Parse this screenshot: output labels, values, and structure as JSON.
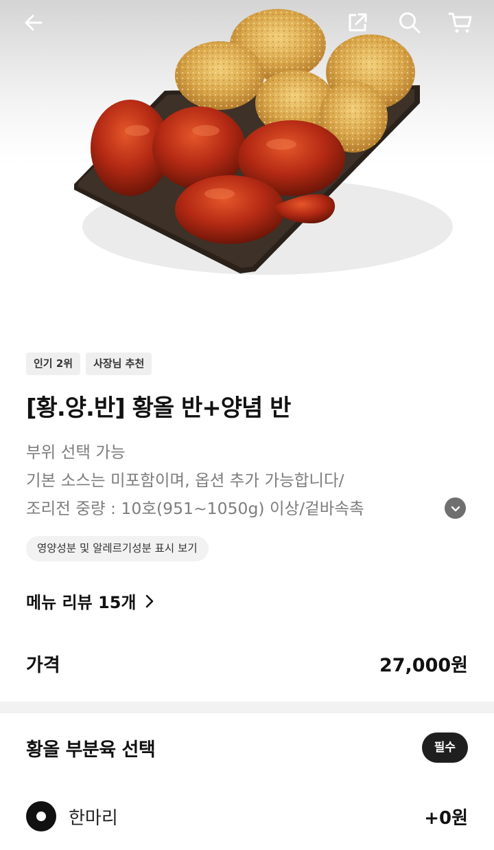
{
  "header": {
    "back_icon": "arrow-left-icon",
    "share_icon": "share-external-icon",
    "search_icon": "search-icon",
    "cart_icon": "cart-icon"
  },
  "product": {
    "badges": [
      "인기 2위",
      "사장님 추천"
    ],
    "title": "[황.양.반] 황올 반+양념 반",
    "description_lines": [
      "부위 선택 가능",
      "기본 소스는 미포함이며, 옵션 추가 가능합니다/",
      "조리전 중량 : 10호(951~1050g) 이상/겉바속촉"
    ],
    "nutrition_link": "영양성분 및 알레르기성분 표시 보기",
    "review_link": "메뉴 리뷰 15개",
    "price_label": "가격",
    "price_value": "27,000원"
  },
  "option_group": {
    "title": "황올 부분육 선택",
    "required_label": "필수",
    "options": [
      {
        "name": "한마리",
        "price": "+0원",
        "selected": true
      }
    ]
  },
  "colors": {
    "text_primary": "#111111",
    "text_secondary": "#7d7d7d",
    "chip_bg": "#efefef",
    "radio_selected": "#111111",
    "divider": "#f2f2f2"
  }
}
